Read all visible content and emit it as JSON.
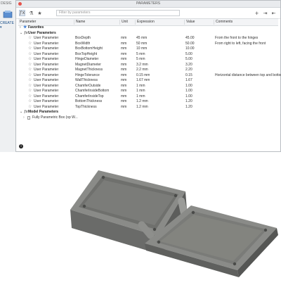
{
  "app": {
    "design_label": "DESIG",
    "create_menu": "CREATE ▾"
  },
  "dialog": {
    "title": "PARAMETERS",
    "search_placeholder": "Filter by parameters"
  },
  "columns": [
    "Parameter",
    "Name",
    "Unit",
    "Expression",
    "Value",
    "Comments"
  ],
  "favorites_label": "Favorites",
  "user_group_label": "User Parameters",
  "user_parameters": [
    {
      "param": "User Parameter",
      "name": "BoxDepth",
      "unit": "mm",
      "expr": "45 mm",
      "value": "45.00",
      "comment": "From the front to the hinges"
    },
    {
      "param": "User Parameter",
      "name": "BoxWidth",
      "unit": "mm",
      "expr": "50 mm",
      "value": "50.00",
      "comment": "From right to left, facing the front"
    },
    {
      "param": "User Parameter",
      "name": "BoxBottomHeight",
      "unit": "mm",
      "expr": "10 mm",
      "value": "10.00",
      "comment": ""
    },
    {
      "param": "User Parameter",
      "name": "BoxTopHeight",
      "unit": "mm",
      "expr": "5 mm",
      "value": "5.00",
      "comment": ""
    },
    {
      "param": "User Parameter",
      "name": "HingeDiameter",
      "unit": "mm",
      "expr": "5 mm",
      "value": "5.00",
      "comment": ""
    },
    {
      "param": "User Parameter",
      "name": "MagnetDiameter",
      "unit": "mm",
      "expr": "3.2 mm",
      "value": "3.20",
      "comment": ""
    },
    {
      "param": "User Parameter",
      "name": "MagnetThickness",
      "unit": "mm",
      "expr": "2.2 mm",
      "value": "2.20",
      "comment": ""
    },
    {
      "param": "User Parameter",
      "name": "HingeTolerance",
      "unit": "mm",
      "expr": "0.15 mm",
      "value": "0.15",
      "comment": "Horizontal distance between top and bottom fr"
    },
    {
      "param": "User Parameter",
      "name": "WallThickness",
      "unit": "mm",
      "expr": "1.67 mm",
      "value": "1.67",
      "comment": ""
    },
    {
      "param": "User Parameter",
      "name": "ChamferOutside",
      "unit": "mm",
      "expr": "1 mm",
      "value": "1.00",
      "comment": ""
    },
    {
      "param": "User Parameter",
      "name": "ChamferInsideBottom",
      "unit": "mm",
      "expr": "1 mm",
      "value": "1.00",
      "comment": ""
    },
    {
      "param": "User Parameter",
      "name": "ChamferInsideTop",
      "unit": "mm",
      "expr": "1 mm",
      "value": "1.00",
      "comment": ""
    },
    {
      "param": "User Parameter",
      "name": "BottomThickness",
      "unit": "mm",
      "expr": "1.2 mm",
      "value": "1.20",
      "comment": ""
    },
    {
      "param": "User Parameter",
      "name": "TopThickness",
      "unit": "mm",
      "expr": "1.2 mm",
      "value": "1.20",
      "comment": ""
    }
  ],
  "model_group_label": "Model Parameters",
  "model_item_label": "Fully Parametric Box (op W...",
  "colors": {
    "accent": "#3a7bd5",
    "body": "#7f807e",
    "body_dark": "#5c5d5b",
    "body_light": "#a4a5a2"
  }
}
